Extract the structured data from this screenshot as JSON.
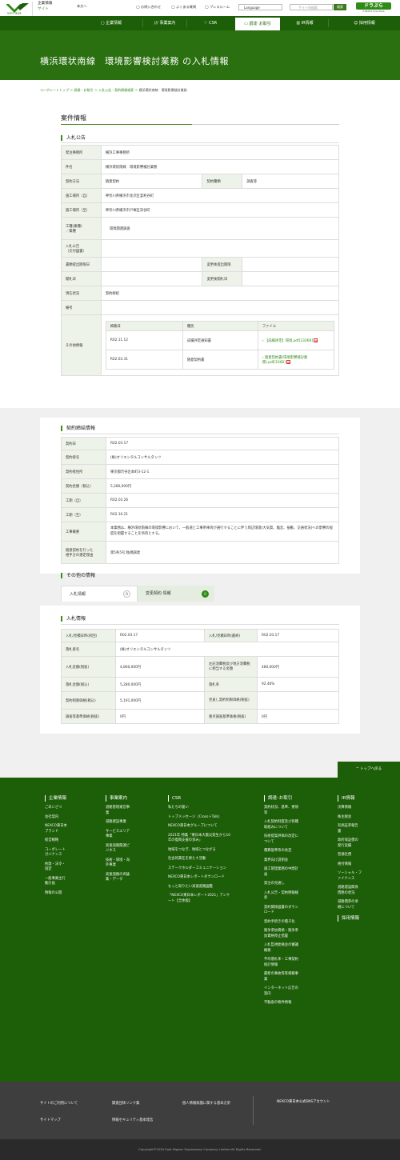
{
  "header": {
    "corp_line1": "企業情報",
    "corp_line2": "サイト",
    "top_link": "本文へ",
    "links": [
      "お問い合わせ",
      "よくある質問",
      "プレスルーム"
    ],
    "language": "Language",
    "search_placeholder": "サイト内検索",
    "search_btn": "検索",
    "dora": "ドラぷら",
    "dora_sub": "E-NEXCO Drive Plaza"
  },
  "gnav": [
    "企業情報",
    "事業案内",
    "CSR",
    "調達･お取引",
    "IR情報",
    "採用情報"
  ],
  "page_title": "横浜環状南線　環境影響検討業務 の入札情報",
  "breadcrumb": [
    "コーポレートトップ",
    "調達・お取引",
    "入札公告・契約情報検索",
    "横浜環状南線　環境影響検討業務"
  ],
  "sec1": {
    "title": "案件情報",
    "sub": "入札公告"
  },
  "bid": {
    "org_l": "発注事務所",
    "org": "横浜工事事務所",
    "name_l": "件名",
    "name": "横浜環状南線　環境影響検討業務",
    "method_l": "契約方法",
    "method": "随意契約",
    "kind_l": "契約種類",
    "kind": "調査等",
    "place_from_l": "施工場所（自）",
    "place_from": "神奈川県横浜市金沢区釜利谷町",
    "place_to_l": "施工場所（至）",
    "place_to": "神奈川県横浜市戸塚区深谷町",
    "type_l": "工種(業種)\n／業種",
    "type": "環境関連調査",
    "notice_l": "入札公告\n（交付図書）",
    "notice": "",
    "doc_date_l": "書類提出期限日",
    "doc_date": "",
    "change_doc_l": "変更後提出期限",
    "change_doc": "",
    "open_l": "開札日",
    "open": "",
    "change_open_l": "変更後開札日",
    "change_open": "",
    "status_l": "現在状況",
    "status": "契約締結",
    "remark_l": "備考",
    "remark": "",
    "other_l": "その他情報",
    "files_head": [
      "掲載日",
      "種別",
      "ファイル"
    ],
    "files": [
      {
        "date": "R02.11.12",
        "kind": "成績評定通知書",
        "file": "【成績評定】環境.pdf[232KB]"
      },
      {
        "date": "R02.03.31",
        "kind": "随意契約書",
        "file": "随意契約書(環境影響検討業務).pdf[31KB]"
      }
    ]
  },
  "sec2": {
    "sub": "契約締結情報"
  },
  "contract": [
    [
      "契約日",
      "R02.03.17"
    ],
    [
      "契約者名",
      "(株)オリエンタルコンサルタンツ"
    ],
    [
      "契約者住所",
      "東京都渋谷区本町3-12-1"
    ],
    [
      "契約金額（税込）",
      "5,280,000円"
    ],
    [
      "工期（自）",
      "R02.03.26"
    ],
    [
      "工期（至）",
      "R02.10.21"
    ],
    [
      "工事概要",
      "本業務は、横浜環状南線の環境影響において、一般道と工事用車両が通行することに伴う周辺環境(大気質、騒音、振動、交通状況)への影響の程度を把握することを目的とする。"
    ],
    [
      "随意契約を行った\n相手方の選定理由",
      "第5条5号:独規調達"
    ]
  ],
  "sec3": {
    "sub": "その他の情報",
    "tab1": "入札情報",
    "tab1_count": "0",
    "tab2": "変更契約 情報",
    "tab2_count": "0",
    "card_title": "入札情報"
  },
  "bidinfo": {
    "r1": [
      "入札/見積日時(初回)",
      "R02.03.17",
      "入札/見積日時(最終)",
      "R02.03.17"
    ],
    "r2": [
      "落札者名",
      "(株)オリエンタルコンサルタンツ"
    ],
    "r3": [
      "入札金額(税抜)",
      "4,800,000円",
      "左記消費税及び地方消費税に相当する金額",
      "480,000円"
    ],
    "r4": [
      "落札金額(税込)",
      "5,280,000円",
      "落札率",
      "92.46%"
    ],
    "r5": [
      "契約制限価格(税込)",
      "5,191,000円",
      "見直し契約制限価格(税抜)",
      ""
    ],
    "r6": [
      "調査等基準価格(税抜)",
      "0円",
      "重点調査基準価格(税抜)",
      "0円"
    ]
  },
  "top_button": "トップへ戻る",
  "footer": {
    "cols": [
      {
        "title": "企業情報",
        "items": [
          "ごあいさつ",
          "会社案内",
          "NEXCO東日本ブランド",
          "経営戦略",
          "コーポレートガバナンス",
          "約款・法令・協定",
          "一般事業主行動計画",
          "情報の公開"
        ]
      },
      {
        "title": "事業案内",
        "items": [
          "道路管理運営事業",
          "道路建設事業",
          "サービスエリア事業",
          "高速道路関連ビジネス",
          "技術・環境・海外事業",
          "高速道路の両論集・データ"
        ]
      },
      {
        "title": "CSR",
        "items": [
          "私たちの誓い",
          "トップメッセージ（Cross＋Talk）",
          "NEXCO東日本グループについて",
          "2021年 特集「東日本大震災発生から10年の復興支援の歩み」",
          "地域をつなぎ、地域とつながる",
          "社会的責任を果たす活動",
          "ステークホルダーコミュニケーション",
          "NEXCO東日本レポートダウンロード",
          "もっと知りたい高速道路図鑑",
          "「NEXCO東日本レポート2021」アンケート【全体版】"
        ]
      },
      {
        "title": "調達･お取引",
        "items": [
          "契約状況、基準、要領等",
          "入札契約制度及び各種取組みについて",
          "技術提案評価の改定について",
          "積算基準等の改定",
          "業界向け説明会",
          "施工管理業務の中間計画",
          "発注の見通し",
          "入札公告・契約情報検索",
          "契約関係図書のダウンロード",
          "契約手続きの電子化",
          "競争参加資格・競争参加資格停止措置",
          "入札監視委員会の審議概要",
          "平均落札率・工事契約統計情報",
          "最新の事故等等掲載事業",
          "インターネット広告の案内",
          "不動産の物件情報"
        ]
      },
      {
        "title": "IR情報",
        "items": [
          "決算情報",
          "株主総会",
          "有価証券報告書",
          "政府保証債の発行実績",
          "普通社債",
          "格付情報",
          "ソーシャル・ファイナンス",
          "道路建設関係債務の状況",
          "道路債券の承継について"
        ]
      }
    ],
    "col5b_title": "採用情報",
    "links": [
      "サイトのご利用について",
      "関連団体リンク集",
      "個人情報保護に関する基本方針",
      "サイトマップ",
      "情報セキュリティ基本理念"
    ],
    "sns": "NEXCO東日本公式SNSアカウント",
    "copyright": "Copyright©2020 East Nippon Expressway Company Limited All Rights Reserved."
  },
  "colors": {
    "brand": "#1d5e08",
    "hero": "#2a6f10",
    "accent": "#3d8a1f"
  }
}
